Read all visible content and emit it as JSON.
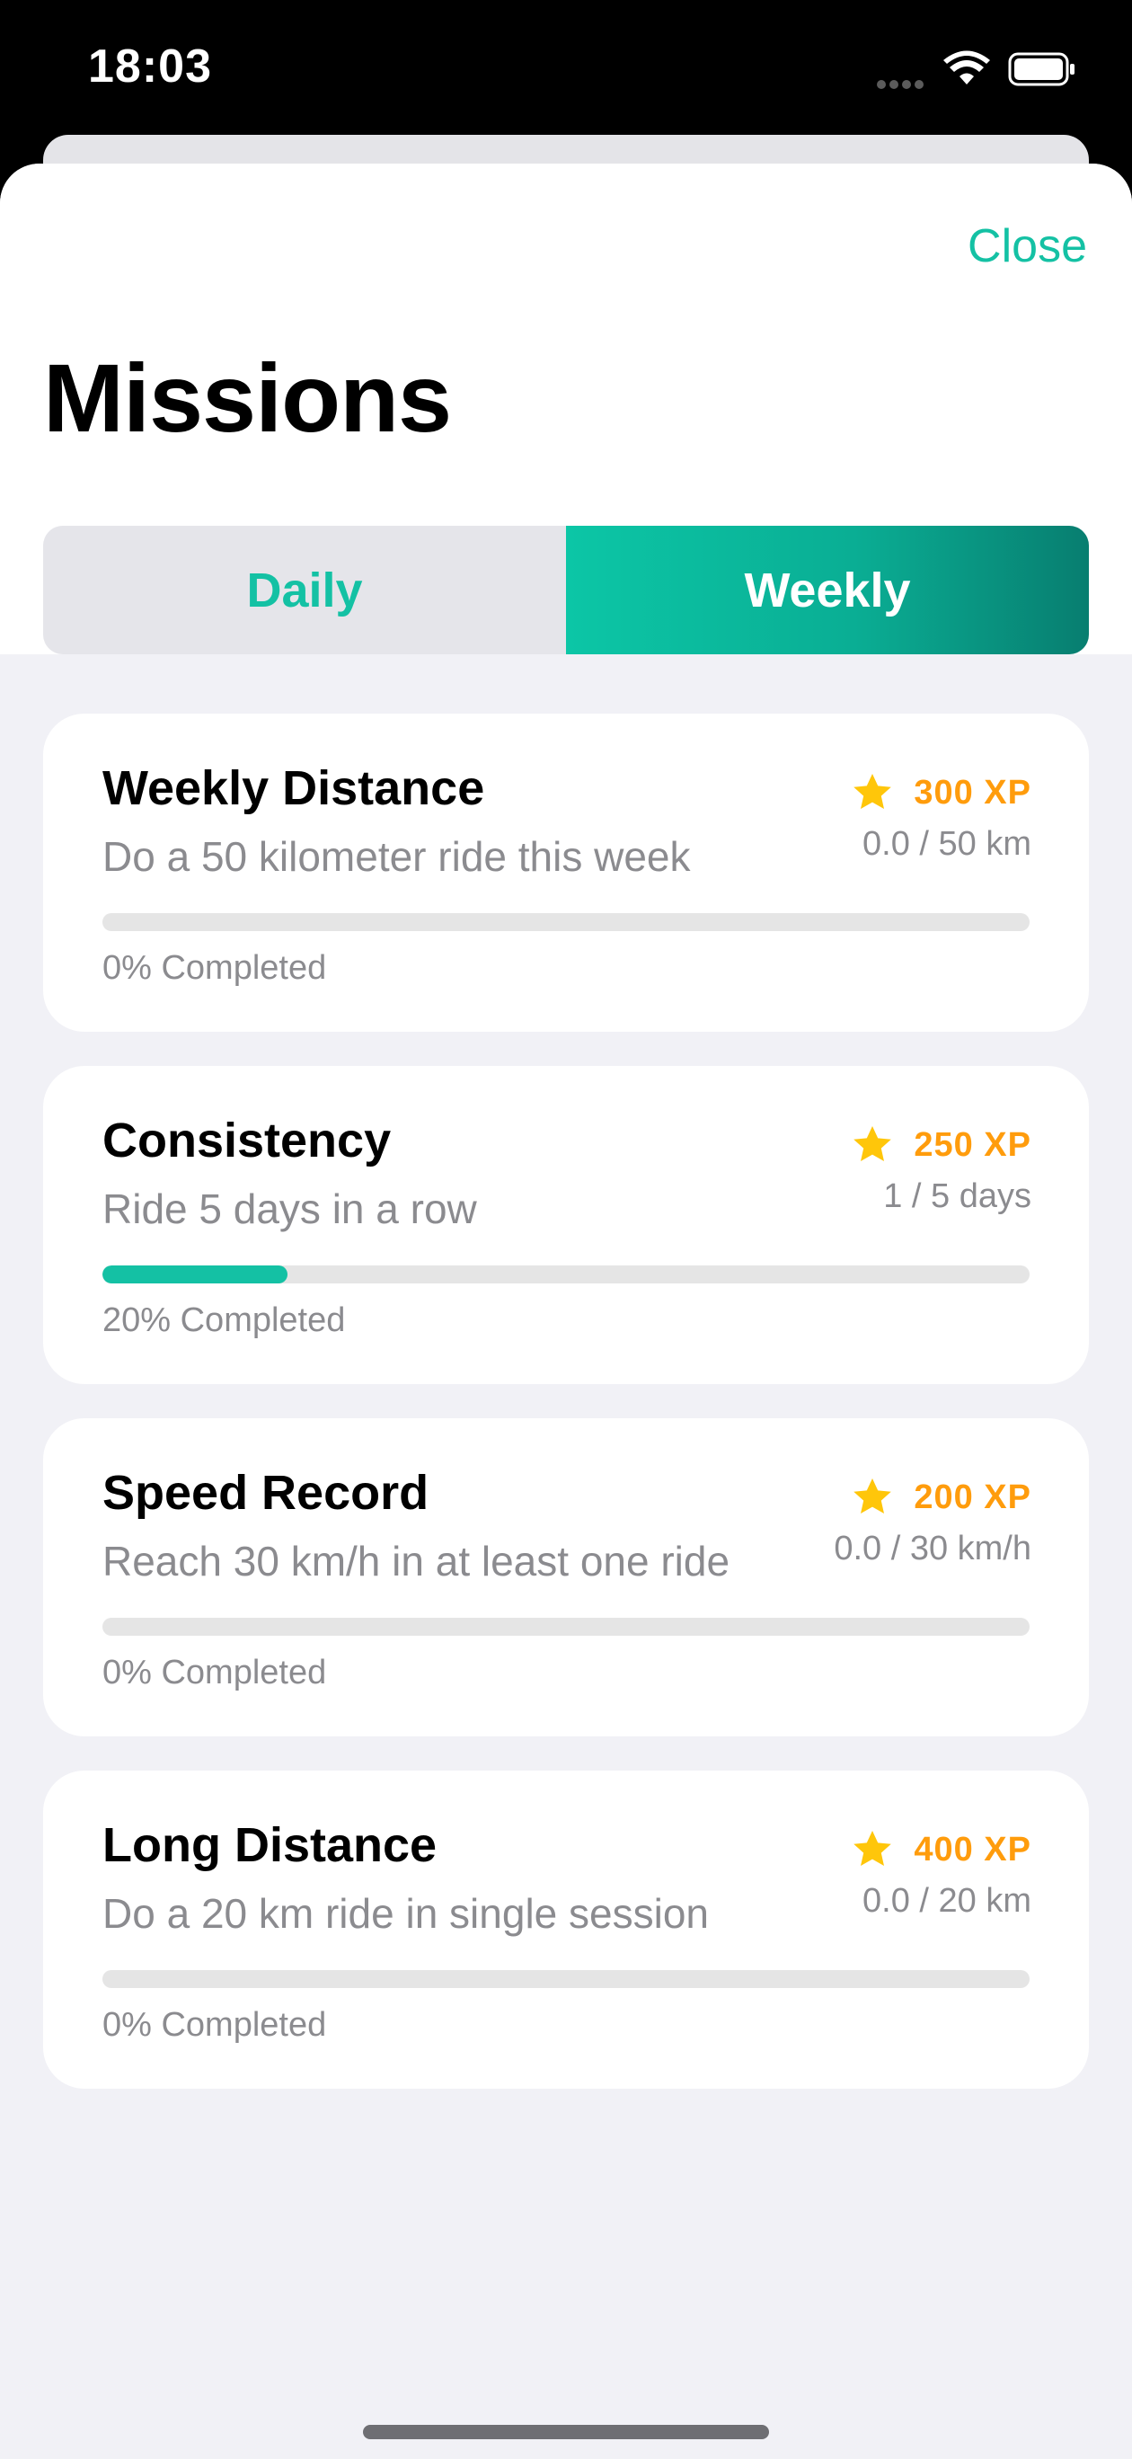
{
  "status_bar": {
    "time": "18:03"
  },
  "header": {
    "close_label": "Close",
    "title": "Missions"
  },
  "tabs": [
    {
      "label": "Daily",
      "selected": false
    },
    {
      "label": "Weekly",
      "selected": true
    }
  ],
  "colors": {
    "accent": "#14c1a4",
    "xp": "#ff9c0c",
    "star": "#ffc60a"
  },
  "missions": [
    {
      "title": "Weekly Distance",
      "description": "Do a 50 kilometer ride this week",
      "xp": "300 XP",
      "progress_text": "0.0 / 50 km",
      "completed_text": "0% Completed",
      "progress": 0
    },
    {
      "title": "Consistency",
      "description": "Ride 5 days in a row",
      "xp": "250 XP",
      "progress_text": "1 / 5 days",
      "completed_text": "20% Completed",
      "progress": 0.2
    },
    {
      "title": "Speed Record",
      "description": "Reach 30 km/h in at least one ride",
      "xp": "200 XP",
      "progress_text": "0.0 / 30 km/h",
      "completed_text": "0% Completed",
      "progress": 0
    },
    {
      "title": "Long Distance",
      "description": "Do a 20 km ride in single session",
      "xp": "400 XP",
      "progress_text": "0.0 / 20 km",
      "completed_text": "0% Completed",
      "progress": 0
    }
  ]
}
